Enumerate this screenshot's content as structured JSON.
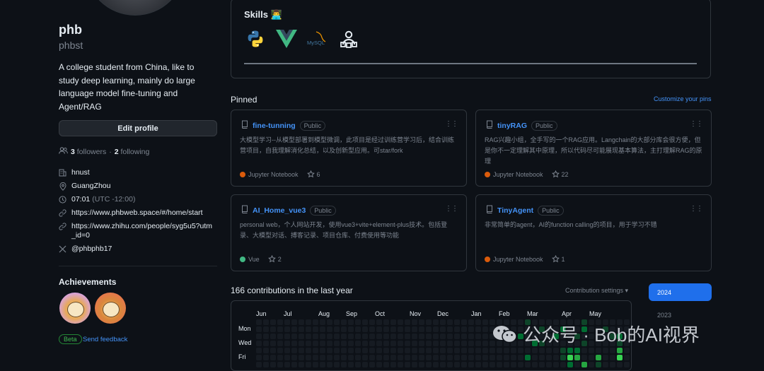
{
  "profile": {
    "name": "phb",
    "login": "phbst",
    "bio": "A college student from China, like to study deep learning, mainly do large language model fine-tuning and Agent/RAG",
    "edit_button": "Edit profile",
    "followers_count": "3",
    "followers_label": "followers",
    "following_count": "2",
    "following_label": "following",
    "separator": "·",
    "details": {
      "organization": "hnust",
      "location": "GuangZhou",
      "time": "07:01",
      "timezone": "(UTC -12:00)",
      "link1": "https://www.phbweb.space/#/home/start",
      "link2": "https://www.zhihu.com/people/syg5u5?utm_id=0",
      "twitter": "@phbphb17"
    },
    "achievements_title": "Achievements",
    "beta_label": "Beta",
    "feedback_label": "Send feedback"
  },
  "skills": {
    "title": "Skills 👨‍💻",
    "icons": [
      "python-icon",
      "vue-icon",
      "mysql-icon",
      "agent-icon"
    ],
    "mysql_text": "MySQL"
  },
  "pinned": {
    "title": "Pinned",
    "customize": "Customize your pins",
    "public_label": "Public",
    "cards": [
      {
        "name": "fine-tunning",
        "desc": "大模型学习--从模型部署到模型微调，此项目是经过训练营学习后，结合训练营项目，自我理解消化总结，以及创新型应用。可star/fork",
        "lang": "Jupyter Notebook",
        "lang_color": "#DA5B0B",
        "stars": "6"
      },
      {
        "name": "tinyRAG",
        "desc": "RAG兴趣小组，全手写的一个RAG应用。Langchain的大部分库会很方便，但是你不一定理解其中原理，所以代码尽可能展现基本算法，主打理解RAG的原理",
        "lang": "Jupyter Notebook",
        "lang_color": "#DA5B0B",
        "stars": "22"
      },
      {
        "name": "AI_Home_vue3",
        "desc": "personal web，个人网站开发，使用vue3+vite+element-plus技术。包括登录、大模型对话、搏客记录、项目仓库、付费使用等功能",
        "lang": "Vue",
        "lang_color": "#41b883",
        "stars": "2"
      },
      {
        "name": "TinyAgent",
        "desc": "非常简单的agent，AI的function calling的项目，用于学习不错",
        "lang": "Jupyter Notebook",
        "lang_color": "#DA5B0B",
        "stars": "1"
      }
    ]
  },
  "contributions": {
    "title": "166 contributions in the last year",
    "settings": "Contribution settings ▾",
    "years": [
      "2024",
      "2023"
    ],
    "months": [
      "Jun",
      "Jul",
      "Aug",
      "Sep",
      "Oct",
      "Nov",
      "Dec",
      "Jan",
      "Feb",
      "Mar",
      "Apr",
      "May"
    ],
    "days": [
      "Mon",
      "Wed",
      "Fri"
    ],
    "colors": [
      "#161b22",
      "#0e4429",
      "#006d32",
      "#26a641",
      "#39d353"
    ],
    "week_columns": 53,
    "levels": {
      "Sun": [
        0,
        0,
        0,
        0,
        0,
        0,
        0,
        0,
        0,
        0,
        0,
        0,
        0,
        0,
        0,
        0,
        0,
        0,
        0,
        0,
        0,
        0,
        0,
        0,
        0,
        0,
        0,
        0,
        0,
        0,
        0,
        0,
        0,
        0,
        0,
        0,
        0,
        0,
        1,
        0,
        0,
        0,
        0,
        0,
        0,
        0,
        1,
        0,
        0,
        0,
        0,
        0,
        0
      ],
      "Mon": [
        0,
        0,
        0,
        0,
        0,
        0,
        0,
        0,
        0,
        0,
        0,
        0,
        0,
        0,
        0,
        0,
        0,
        0,
        0,
        0,
        0,
        0,
        0,
        0,
        0,
        0,
        0,
        0,
        0,
        0,
        0,
        0,
        0,
        0,
        0,
        0,
        0,
        0,
        0,
        0,
        1,
        0,
        0,
        2,
        0,
        0,
        2,
        0,
        0,
        1,
        0,
        0,
        0
      ],
      "Tue": [
        0,
        0,
        0,
        0,
        0,
        0,
        0,
        0,
        0,
        0,
        0,
        0,
        0,
        0,
        0,
        0,
        0,
        0,
        0,
        0,
        0,
        0,
        0,
        0,
        0,
        0,
        0,
        0,
        0,
        0,
        0,
        0,
        0,
        0,
        0,
        0,
        0,
        2,
        0,
        0,
        0,
        0,
        2,
        0,
        0,
        1,
        0,
        0,
        0,
        0,
        1,
        2,
        0
      ],
      "Wed": [
        0,
        0,
        0,
        0,
        0,
        0,
        0,
        0,
        0,
        0,
        0,
        0,
        0,
        0,
        0,
        0,
        0,
        0,
        0,
        0,
        0,
        0,
        0,
        0,
        0,
        0,
        0,
        0,
        0,
        0,
        0,
        0,
        0,
        0,
        0,
        0,
        0,
        0,
        0,
        2,
        1,
        0,
        0,
        0,
        0,
        0,
        1,
        0,
        0,
        0,
        0,
        1,
        0
      ],
      "Thu": [
        0,
        0,
        0,
        0,
        0,
        0,
        0,
        0,
        0,
        0,
        0,
        0,
        0,
        0,
        0,
        0,
        0,
        0,
        0,
        0,
        0,
        0,
        0,
        0,
        0,
        0,
        0,
        0,
        0,
        0,
        0,
        0,
        0,
        0,
        0,
        0,
        0,
        0,
        0,
        0,
        0,
        0,
        0,
        1,
        2,
        2,
        0,
        0,
        0,
        0,
        0,
        3,
        0
      ],
      "Fri": [
        0,
        0,
        0,
        0,
        0,
        0,
        0,
        0,
        0,
        0,
        0,
        0,
        0,
        0,
        0,
        0,
        0,
        0,
        0,
        0,
        0,
        0,
        0,
        0,
        0,
        0,
        0,
        0,
        0,
        0,
        0,
        0,
        0,
        0,
        0,
        0,
        0,
        0,
        2,
        0,
        0,
        0,
        0,
        1,
        4,
        3,
        0,
        0,
        3,
        0,
        0,
        4,
        0
      ],
      "Sat": [
        0,
        0,
        0,
        0,
        0,
        0,
        0,
        0,
        0,
        0,
        0,
        0,
        0,
        0,
        0,
        0,
        0,
        0,
        0,
        0,
        0,
        0,
        0,
        0,
        0,
        0,
        0,
        0,
        0,
        0,
        0,
        0,
        0,
        0,
        0,
        0,
        0,
        0,
        0,
        0,
        0,
        0,
        0,
        0,
        2,
        0,
        3,
        0,
        1,
        0,
        0,
        0,
        0
      ]
    }
  },
  "watermark": {
    "text": "公众号 · Bob的AI视界"
  }
}
